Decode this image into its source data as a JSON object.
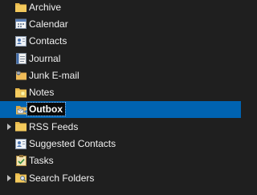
{
  "folders": [
    {
      "label": "Archive",
      "icon": "archive-folder-icon",
      "selected": false,
      "expandable": false
    },
    {
      "label": "Calendar",
      "icon": "calendar-icon",
      "selected": false,
      "expandable": false
    },
    {
      "label": "Contacts",
      "icon": "contacts-icon",
      "selected": false,
      "expandable": false
    },
    {
      "label": "Journal",
      "icon": "journal-icon",
      "selected": false,
      "expandable": false
    },
    {
      "label": "Junk E-mail",
      "icon": "junk-email-icon",
      "selected": false,
      "expandable": false
    },
    {
      "label": "Notes",
      "icon": "notes-icon",
      "selected": false,
      "expandable": false
    },
    {
      "label": "Outbox",
      "icon": "outbox-icon",
      "selected": true,
      "expandable": false
    },
    {
      "label": "RSS Feeds",
      "icon": "rss-folder-icon",
      "selected": false,
      "expandable": true
    },
    {
      "label": "Suggested Contacts",
      "icon": "suggested-contacts-icon",
      "selected": false,
      "expandable": false
    },
    {
      "label": "Tasks",
      "icon": "tasks-icon",
      "selected": false,
      "expandable": false
    },
    {
      "label": "Search Folders",
      "icon": "search-folders-icon",
      "selected": false,
      "expandable": true
    }
  ],
  "colors": {
    "background": "#1f1f1f",
    "selection": "#0063b1",
    "text": "#f0f0f0"
  }
}
